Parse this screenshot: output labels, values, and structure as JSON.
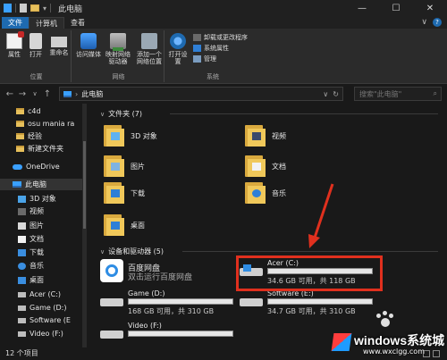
{
  "window": {
    "title": "此电脑",
    "controls": {
      "minimize": "—",
      "maximize": "☐",
      "close": "✕"
    }
  },
  "ribbon_tabs": {
    "file": "文件",
    "computer": "计算机",
    "view": "查看"
  },
  "ribbon": {
    "location_group": "位置",
    "network_group": "网络",
    "system_group": "系统",
    "properties": "属性",
    "open": "打开",
    "rename": "重命名",
    "access_media": "访问媒体",
    "map_drive": "映射网络驱动器",
    "add_location": "添加一个网络位置",
    "open_settings": "打开设置",
    "uninstall": "卸载或更改程序",
    "system_props": "系统属性",
    "manage": "管理"
  },
  "address": {
    "path": "此电脑",
    "search_placeholder": "搜索\"此电脑\""
  },
  "sidebar": {
    "items": [
      {
        "label": "c4d"
      },
      {
        "label": "osu mania ra"
      },
      {
        "label": "经验"
      },
      {
        "label": "新建文件夹"
      },
      {
        "label": "OneDrive"
      },
      {
        "label": "此电脑"
      },
      {
        "label": "3D 对象"
      },
      {
        "label": "视频"
      },
      {
        "label": "图片"
      },
      {
        "label": "文档"
      },
      {
        "label": "下载"
      },
      {
        "label": "音乐"
      },
      {
        "label": "桌面"
      },
      {
        "label": "Acer (C:)"
      },
      {
        "label": "Game (D:)"
      },
      {
        "label": "Software (E"
      },
      {
        "label": "Video (F:)"
      }
    ]
  },
  "folders_section": "文件夹 (7)",
  "folders": [
    {
      "label": "3D 对象"
    },
    {
      "label": "视频"
    },
    {
      "label": "图片"
    },
    {
      "label": "文档"
    },
    {
      "label": "下载"
    },
    {
      "label": "音乐"
    },
    {
      "label": "桌面"
    }
  ],
  "devices_section": "设备和驱动器 (5)",
  "app": {
    "name": "百度网盘",
    "desc": "双击运行百度网盘"
  },
  "drives": [
    {
      "name": "Acer (C:)",
      "info": "34.6 GB 可用，共 118 GB",
      "used_fraction": 0.71
    },
    {
      "name": "Game (D:)",
      "info": "168 GB 可用，共 310 GB",
      "used_fraction": 0.46
    },
    {
      "name": "Software (E:)",
      "info": "34.7 GB 可用，共 310 GB",
      "used_fraction": 0.89
    },
    {
      "name": "Video (F:)",
      "info": "",
      "used_fraction": 0.87
    }
  ],
  "status": {
    "count": "12 个项目"
  },
  "watermark": {
    "text": "windows系统城",
    "sub": "www.wxclgg.com"
  },
  "colors": {
    "accent": "#26a0da",
    "highlight": "#e0301e",
    "folder": "#f0c85a"
  }
}
